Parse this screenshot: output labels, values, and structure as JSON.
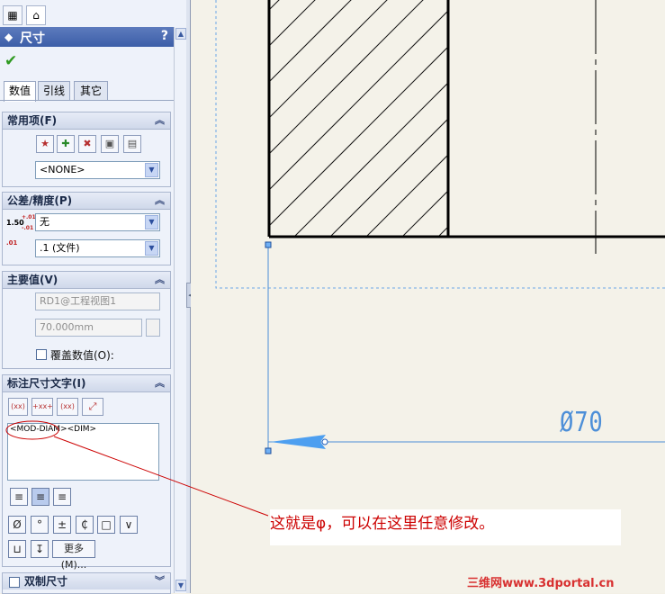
{
  "title_bar": {
    "title": "尺寸",
    "help": "?"
  },
  "confirm": {
    "icon": "checkmark-icon"
  },
  "tabs": [
    "数值",
    "引线",
    "其它"
  ],
  "groups": {
    "common": {
      "title": "常用项(F)",
      "style_value": "<NONE>"
    },
    "tolerance": {
      "title": "公差/精度(P)",
      "tol_icon_top": "1.50",
      "tol_icon_sup": "+.01",
      "tol_icon_sub": "-.01",
      "tol_value": "无",
      "prec_icon": ".01",
      "prec_value": ".1 (文件)"
    },
    "primary": {
      "title": "主要值(V)",
      "reference": "RD1@工程视图1",
      "value": "70.000mm",
      "override_label": "覆盖数值(O):"
    },
    "dimtext": {
      "title": "标注尺寸文字(I)",
      "btn1": "(xx)",
      "btn2": "+xx+",
      "btn3": "(xx)",
      "text_value": "<MOD-DIAM><DIM>",
      "more_label": "更多(M)..."
    },
    "dual": {
      "title": "双制尺寸"
    }
  },
  "symbols": [
    "Ø",
    "°",
    "±",
    "₵",
    "□",
    "∨",
    "⊔",
    "↧"
  ],
  "drawing": {
    "dimension_label": "Ø70"
  },
  "callout": {
    "text": "这就是φ，可以在这里任意修改。"
  },
  "watermark": "三维网www.3dportal.cn",
  "colors": {
    "accent": "#3c5ea8",
    "dimension": "#4d8fd8",
    "annotation": "#c00000"
  }
}
